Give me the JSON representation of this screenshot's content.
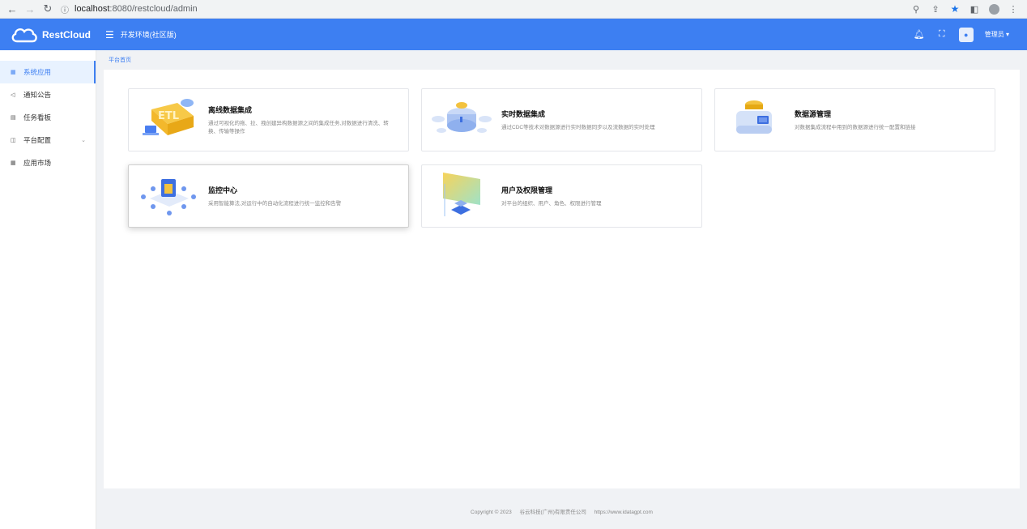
{
  "browser": {
    "url_host": "localhost",
    "url_path": ":8080/restcloud/admin"
  },
  "header": {
    "logo_text": "RestCloud",
    "env_label": "开发环境(社区版)",
    "user_name": "管理员 ▾"
  },
  "sidebar": {
    "items": [
      {
        "label": "系统应用",
        "icon": "grid-icon"
      },
      {
        "label": "通知公告",
        "icon": "megaphone-icon"
      },
      {
        "label": "任务看板",
        "icon": "calendar-icon"
      },
      {
        "label": "平台配置",
        "icon": "settings-icon"
      },
      {
        "label": "应用市场",
        "icon": "grid-icon"
      }
    ]
  },
  "breadcrumb": "平台首页",
  "cards": [
    {
      "title": "离线数据集成",
      "desc": "通过可视化的拖、拉、拽创建异构数据源之间的集成任务,对数据进行清洗、转换、传输等操作"
    },
    {
      "title": "实时数据集成",
      "desc": "通过CDC等技术对数据源进行实时数据同步以及流数据的实时处理"
    },
    {
      "title": "数据源管理",
      "desc": "对数据集成流程中用到的数据源进行统一配置和链接"
    },
    {
      "title": "监控中心",
      "desc": "采用智能算法,对运行中的自动化流程进行统一监控和告警"
    },
    {
      "title": "用户及权限管理",
      "desc": "对平台的组织、用户、角色、权限进行管理"
    }
  ],
  "footer": {
    "copyright": "Copyright © 2023",
    "company": "谷云科技(广州)有限责任公司",
    "url": "https://www.idatagpt.com"
  }
}
